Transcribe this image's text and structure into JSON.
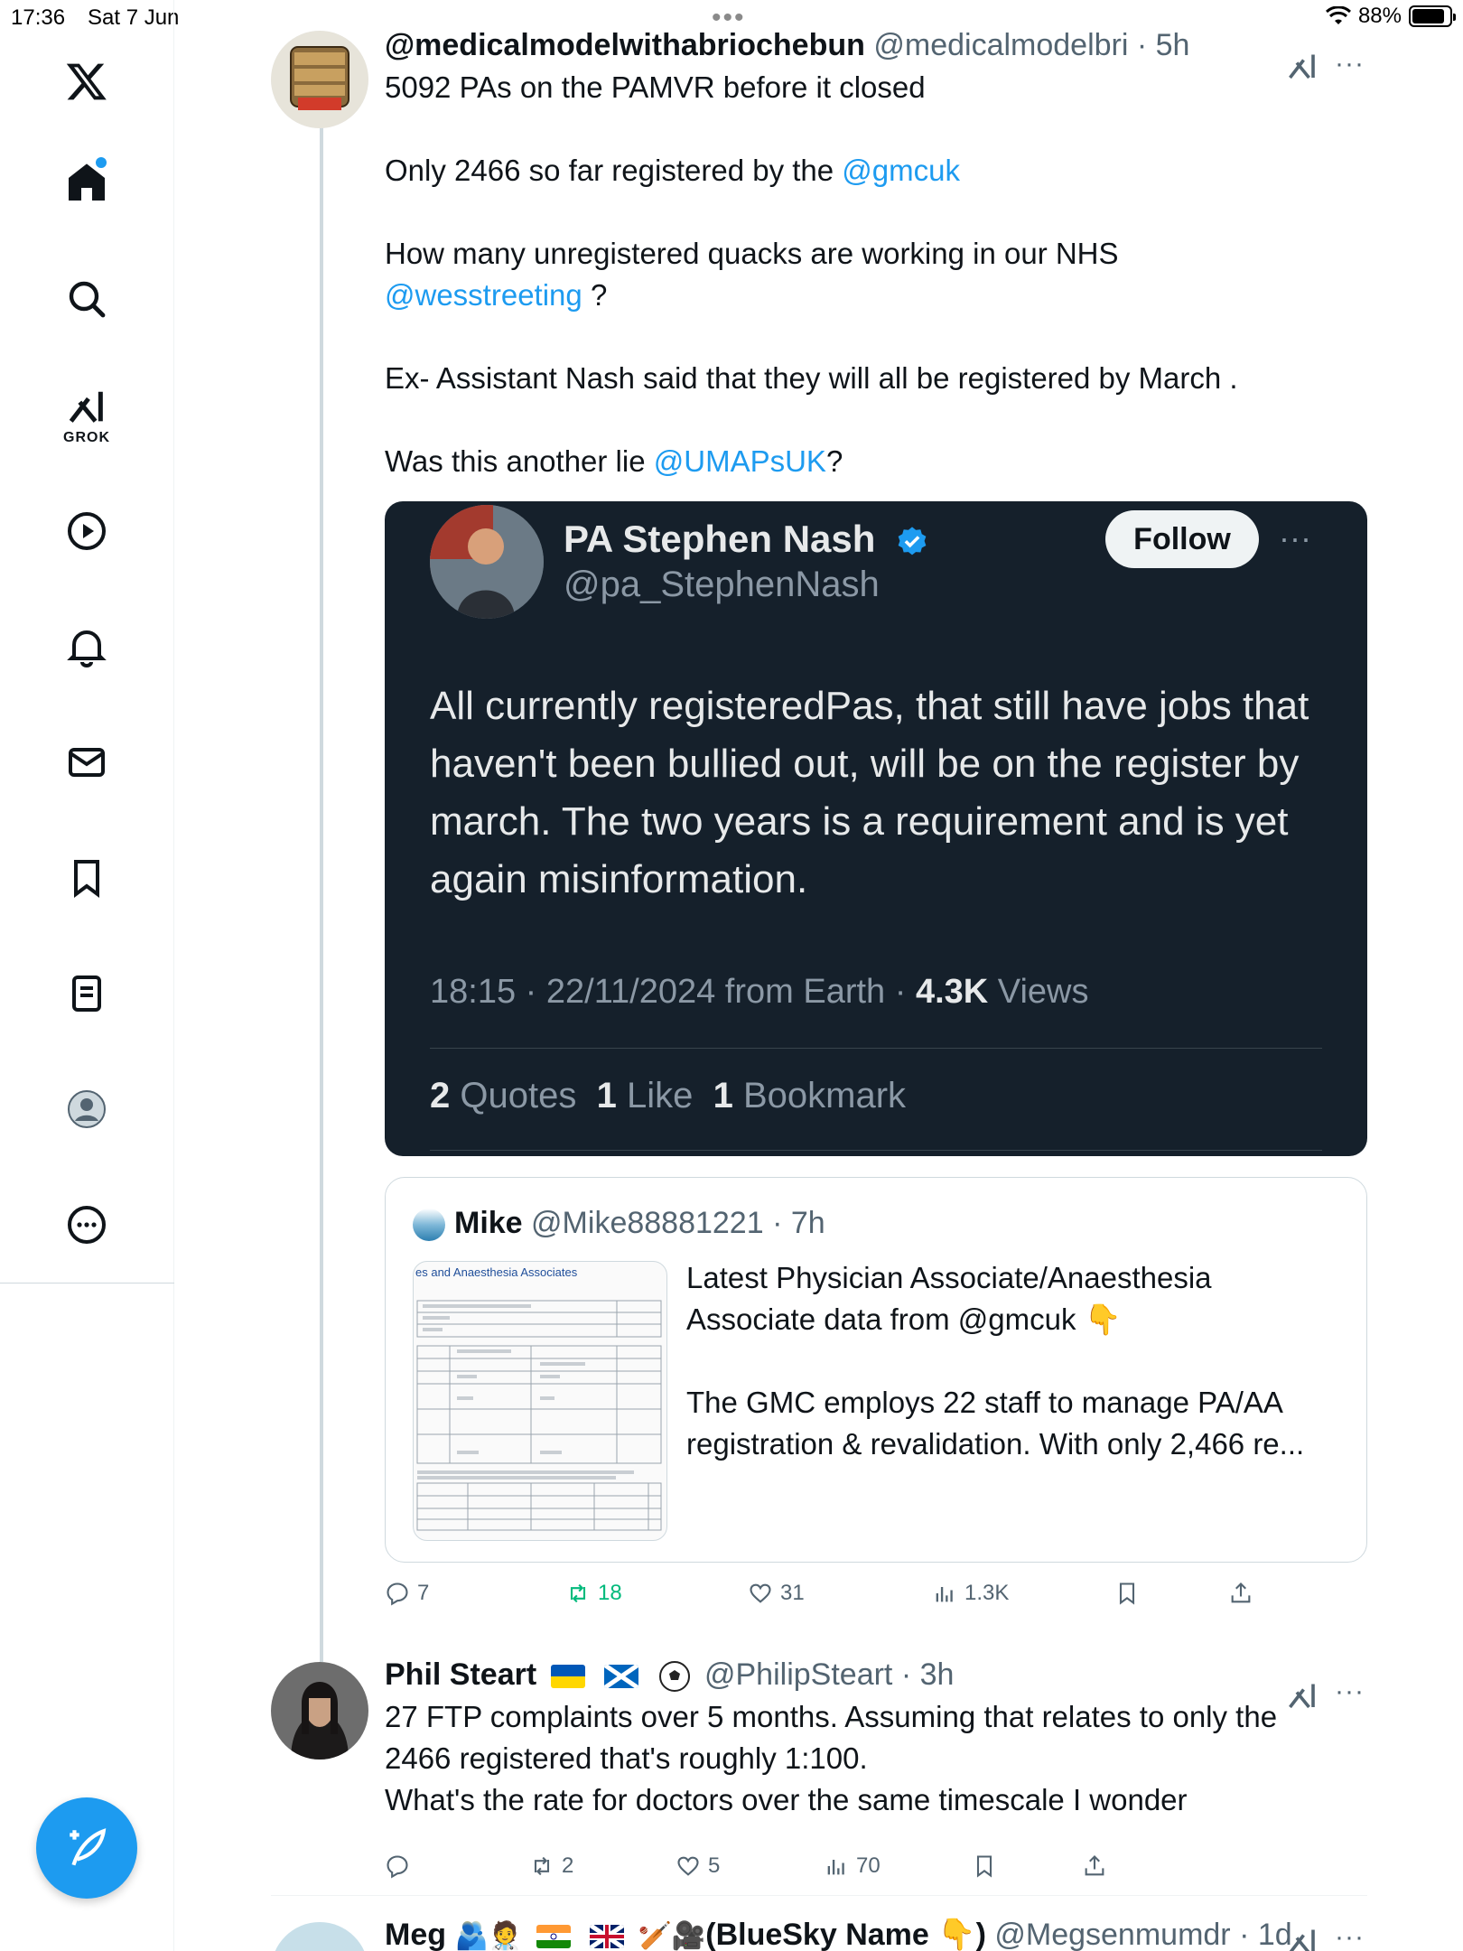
{
  "status_bar": {
    "time": "17:36",
    "date": "Sat 7 Jun",
    "battery": "88%"
  },
  "sidebar": {
    "items": [
      {
        "name": "home"
      },
      {
        "name": "explore"
      },
      {
        "name": "grok",
        "label": "GROK"
      },
      {
        "name": "video"
      },
      {
        "name": "notifications"
      },
      {
        "name": "messages"
      },
      {
        "name": "bookmarks"
      },
      {
        "name": "lists"
      },
      {
        "name": "profile"
      },
      {
        "name": "more"
      }
    ]
  },
  "tweets": [
    {
      "display_name": "@medicalmodelwithabriochebun",
      "handle": "@medicalmodelbri",
      "time": "5h",
      "lines": [
        "5092 PAs on the PAMVR before it closed",
        "Only 2466 so far registered by the",
        "@gmcuk",
        "How many unregistered quacks are working in our NHS",
        "@wesstreeting",
        "?",
        "Ex- Assistant Nash said that they will all be registered by March .",
        "Was this another lie",
        "@UMAPsUK",
        "?"
      ],
      "quoted_image": {
        "name": "PA Stephen Nash",
        "handle": "@pa_StephenNash",
        "follow_label": "Follow",
        "text": "All currently registeredPas, that still have jobs that haven't been bullied out, will be on the register by march. The two years is a requirement and is yet again misinformation.",
        "meta_prefix": "18:15 · 22/11/2024 from Earth ·",
        "views_count": "4.3K",
        "views_label": "Views",
        "quotes_count": "2",
        "quotes_label": "Quotes",
        "likes_count": "1",
        "likes_label": "Like",
        "bookmarks_count": "1",
        "bookmarks_label": "Bookmark"
      },
      "quoted_tweet": {
        "name": "Mike",
        "handle": "@Mike88881221",
        "time": "7h",
        "line1": "Latest Physician Associate/Anaesthesia Associate data from @gmcuk 👇",
        "line2": "The GMC employs 22 staff to manage PA/AA registration & revalidation. With only 2,466 re...",
        "thumb_title": "es and Anaesthesia Associates"
      },
      "actions": {
        "replies": "7",
        "retweets": "18",
        "likes": "31",
        "views": "1.3K"
      }
    },
    {
      "display_name": "Phil Steart",
      "handle": "@PhilipSteart",
      "time": "3h",
      "lines": [
        "27 FTP complaints over 5 months. Assuming that relates to only the",
        "2466 registered that's roughly 1:100.",
        "What's the rate for doctors over the same timescale I wonder"
      ],
      "actions": {
        "replies": "",
        "retweets": "2",
        "likes": "5",
        "views": "70"
      }
    },
    {
      "display_name": "Meg",
      "display_suffix": "(BlueSky Name 👇)",
      "handle": "@Megsenmumdr",
      "time": "1d"
    }
  ],
  "colors": {
    "accent": "#1d9bf0",
    "retweet": "#00ba7c",
    "dark_card": "#15202b"
  }
}
